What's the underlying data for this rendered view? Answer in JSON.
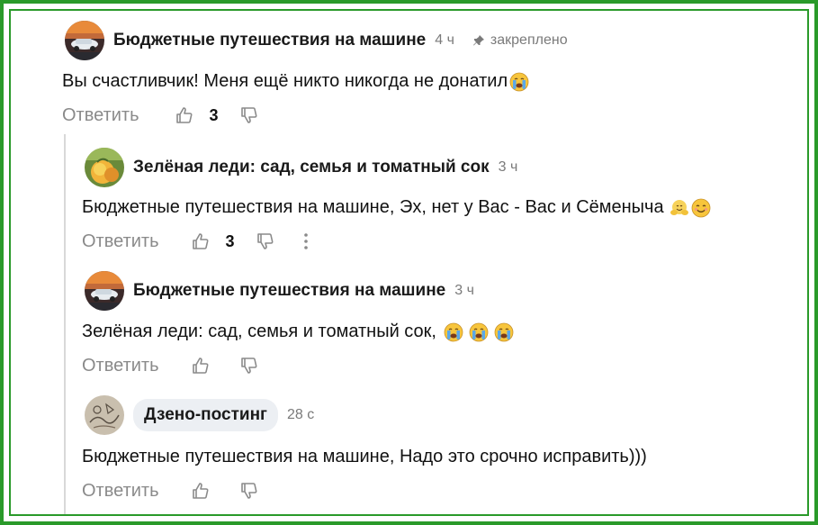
{
  "comments": [
    {
      "author": "Бюджетные путешествия на машине",
      "time": "4 ч",
      "pinned": "закреплено",
      "text": "Вы счастливчик! Меня ещё никто никогда не донатил",
      "reply": "Ответить",
      "likes": "3",
      "avatar_icon": "car-avatar"
    },
    {
      "author": "Зелёная леди: сад, семья и томатный сок",
      "time": "3 ч",
      "text": "Бюджетные путешествия на машине, Эх, нет у Вас - Вас и Сёменыча",
      "reply": "Ответить",
      "likes": "3",
      "avatar_icon": "peach-avatar"
    },
    {
      "author": "Бюджетные путешествия на машине",
      "time": "3 ч",
      "text": "Зелёная леди: сад, семья и томатный сок,",
      "reply": "Ответить",
      "avatar_icon": "car-avatar"
    },
    {
      "author": "Дзено-постинг",
      "time": "28 с",
      "text": "Бюджетные путешествия на машине, Надо это срочно исправить)))",
      "reply": "Ответить",
      "avatar_icon": "sketch-avatar"
    }
  ],
  "colors": {
    "frame": "#2a9a2a",
    "muted": "#8a8a8a",
    "thread_line": "#d8d8d8"
  }
}
